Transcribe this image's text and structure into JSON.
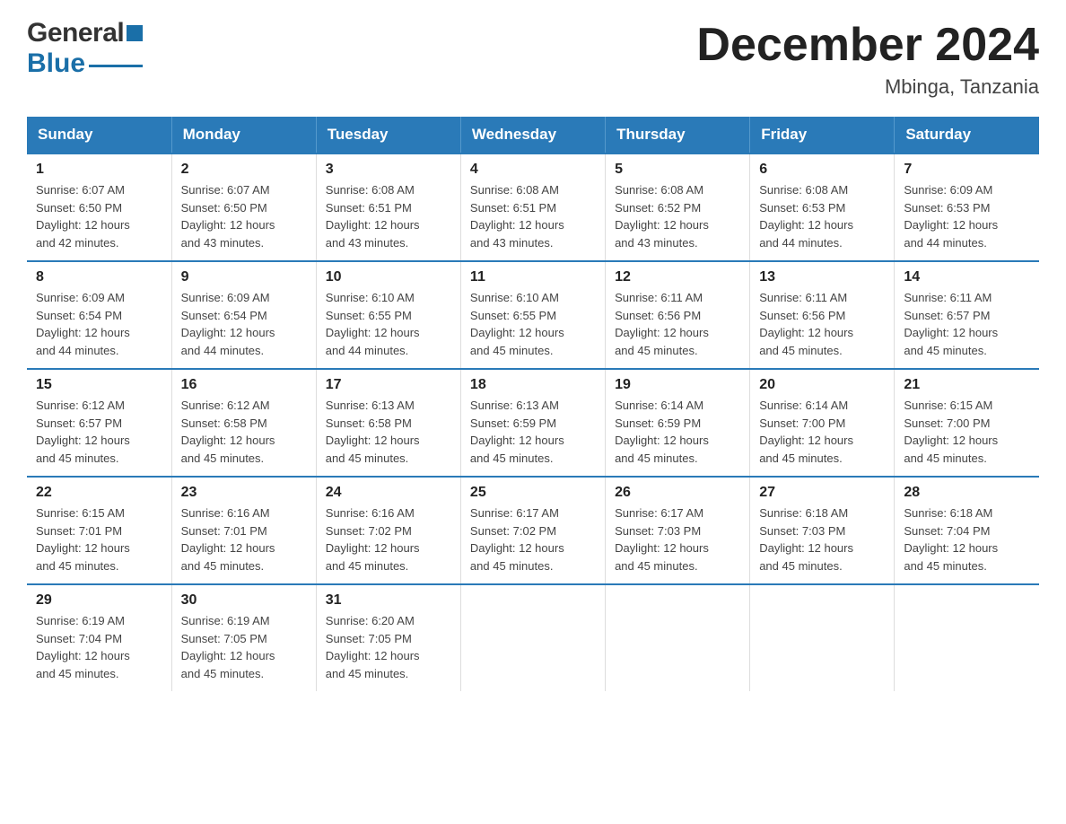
{
  "header": {
    "month_title": "December 2024",
    "location": "Mbinga, Tanzania",
    "logo_general": "General",
    "logo_blue": "Blue"
  },
  "weekdays": [
    "Sunday",
    "Monday",
    "Tuesday",
    "Wednesday",
    "Thursday",
    "Friday",
    "Saturday"
  ],
  "weeks": [
    [
      {
        "day": "1",
        "sunrise": "6:07 AM",
        "sunset": "6:50 PM",
        "daylight": "12 hours and 42 minutes."
      },
      {
        "day": "2",
        "sunrise": "6:07 AM",
        "sunset": "6:50 PM",
        "daylight": "12 hours and 43 minutes."
      },
      {
        "day": "3",
        "sunrise": "6:08 AM",
        "sunset": "6:51 PM",
        "daylight": "12 hours and 43 minutes."
      },
      {
        "day": "4",
        "sunrise": "6:08 AM",
        "sunset": "6:51 PM",
        "daylight": "12 hours and 43 minutes."
      },
      {
        "day": "5",
        "sunrise": "6:08 AM",
        "sunset": "6:52 PM",
        "daylight": "12 hours and 43 minutes."
      },
      {
        "day": "6",
        "sunrise": "6:08 AM",
        "sunset": "6:53 PM",
        "daylight": "12 hours and 44 minutes."
      },
      {
        "day": "7",
        "sunrise": "6:09 AM",
        "sunset": "6:53 PM",
        "daylight": "12 hours and 44 minutes."
      }
    ],
    [
      {
        "day": "8",
        "sunrise": "6:09 AM",
        "sunset": "6:54 PM",
        "daylight": "12 hours and 44 minutes."
      },
      {
        "day": "9",
        "sunrise": "6:09 AM",
        "sunset": "6:54 PM",
        "daylight": "12 hours and 44 minutes."
      },
      {
        "day": "10",
        "sunrise": "6:10 AM",
        "sunset": "6:55 PM",
        "daylight": "12 hours and 44 minutes."
      },
      {
        "day": "11",
        "sunrise": "6:10 AM",
        "sunset": "6:55 PM",
        "daylight": "12 hours and 45 minutes."
      },
      {
        "day": "12",
        "sunrise": "6:11 AM",
        "sunset": "6:56 PM",
        "daylight": "12 hours and 45 minutes."
      },
      {
        "day": "13",
        "sunrise": "6:11 AM",
        "sunset": "6:56 PM",
        "daylight": "12 hours and 45 minutes."
      },
      {
        "day": "14",
        "sunrise": "6:11 AM",
        "sunset": "6:57 PM",
        "daylight": "12 hours and 45 minutes."
      }
    ],
    [
      {
        "day": "15",
        "sunrise": "6:12 AM",
        "sunset": "6:57 PM",
        "daylight": "12 hours and 45 minutes."
      },
      {
        "day": "16",
        "sunrise": "6:12 AM",
        "sunset": "6:58 PM",
        "daylight": "12 hours and 45 minutes."
      },
      {
        "day": "17",
        "sunrise": "6:13 AM",
        "sunset": "6:58 PM",
        "daylight": "12 hours and 45 minutes."
      },
      {
        "day": "18",
        "sunrise": "6:13 AM",
        "sunset": "6:59 PM",
        "daylight": "12 hours and 45 minutes."
      },
      {
        "day": "19",
        "sunrise": "6:14 AM",
        "sunset": "6:59 PM",
        "daylight": "12 hours and 45 minutes."
      },
      {
        "day": "20",
        "sunrise": "6:14 AM",
        "sunset": "7:00 PM",
        "daylight": "12 hours and 45 minutes."
      },
      {
        "day": "21",
        "sunrise": "6:15 AM",
        "sunset": "7:00 PM",
        "daylight": "12 hours and 45 minutes."
      }
    ],
    [
      {
        "day": "22",
        "sunrise": "6:15 AM",
        "sunset": "7:01 PM",
        "daylight": "12 hours and 45 minutes."
      },
      {
        "day": "23",
        "sunrise": "6:16 AM",
        "sunset": "7:01 PM",
        "daylight": "12 hours and 45 minutes."
      },
      {
        "day": "24",
        "sunrise": "6:16 AM",
        "sunset": "7:02 PM",
        "daylight": "12 hours and 45 minutes."
      },
      {
        "day": "25",
        "sunrise": "6:17 AM",
        "sunset": "7:02 PM",
        "daylight": "12 hours and 45 minutes."
      },
      {
        "day": "26",
        "sunrise": "6:17 AM",
        "sunset": "7:03 PM",
        "daylight": "12 hours and 45 minutes."
      },
      {
        "day": "27",
        "sunrise": "6:18 AM",
        "sunset": "7:03 PM",
        "daylight": "12 hours and 45 minutes."
      },
      {
        "day": "28",
        "sunrise": "6:18 AM",
        "sunset": "7:04 PM",
        "daylight": "12 hours and 45 minutes."
      }
    ],
    [
      {
        "day": "29",
        "sunrise": "6:19 AM",
        "sunset": "7:04 PM",
        "daylight": "12 hours and 45 minutes."
      },
      {
        "day": "30",
        "sunrise": "6:19 AM",
        "sunset": "7:05 PM",
        "daylight": "12 hours and 45 minutes."
      },
      {
        "day": "31",
        "sunrise": "6:20 AM",
        "sunset": "7:05 PM",
        "daylight": "12 hours and 45 minutes."
      },
      null,
      null,
      null,
      null
    ]
  ],
  "labels": {
    "sunrise": "Sunrise:",
    "sunset": "Sunset:",
    "daylight": "Daylight: 12 hours"
  }
}
